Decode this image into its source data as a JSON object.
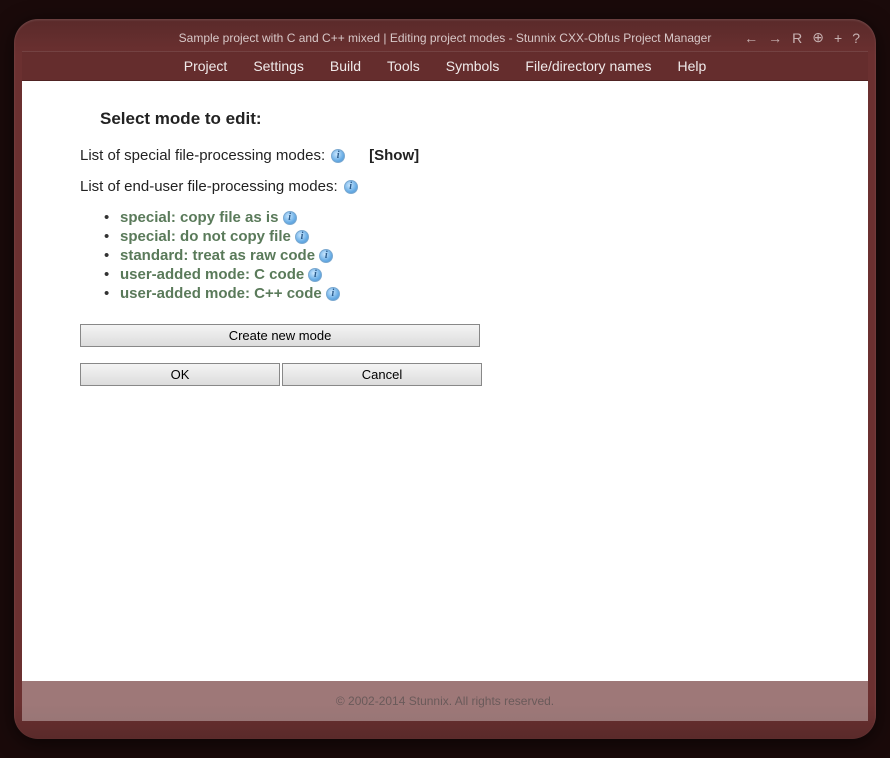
{
  "title": "Sample project with C and C++ mixed | Editing project modes - Stunnix CXX-Obfus Project Manager",
  "toolbar_icons": {
    "back": "←",
    "forward": "→",
    "reload": "R",
    "zoom": "⊕",
    "add": "+",
    "help": "?"
  },
  "menubar": [
    "Project",
    "Settings",
    "Build",
    "Tools",
    "Symbols",
    "File/directory names",
    "Help"
  ],
  "heading": "Select mode to edit:",
  "special_label": "List of special file-processing modes:",
  "show_label": "[Show]",
  "enduser_label": "List of end-user file-processing modes:",
  "modes": [
    "special: copy file as is",
    "special: do not copy file",
    "standard: treat as raw code",
    "user-added mode: C code",
    "user-added mode: C++ code"
  ],
  "create_button": "Create new mode",
  "ok_button": "OK",
  "cancel_button": "Cancel",
  "footer": "© 2002-2014 Stunnix. All rights reserved."
}
